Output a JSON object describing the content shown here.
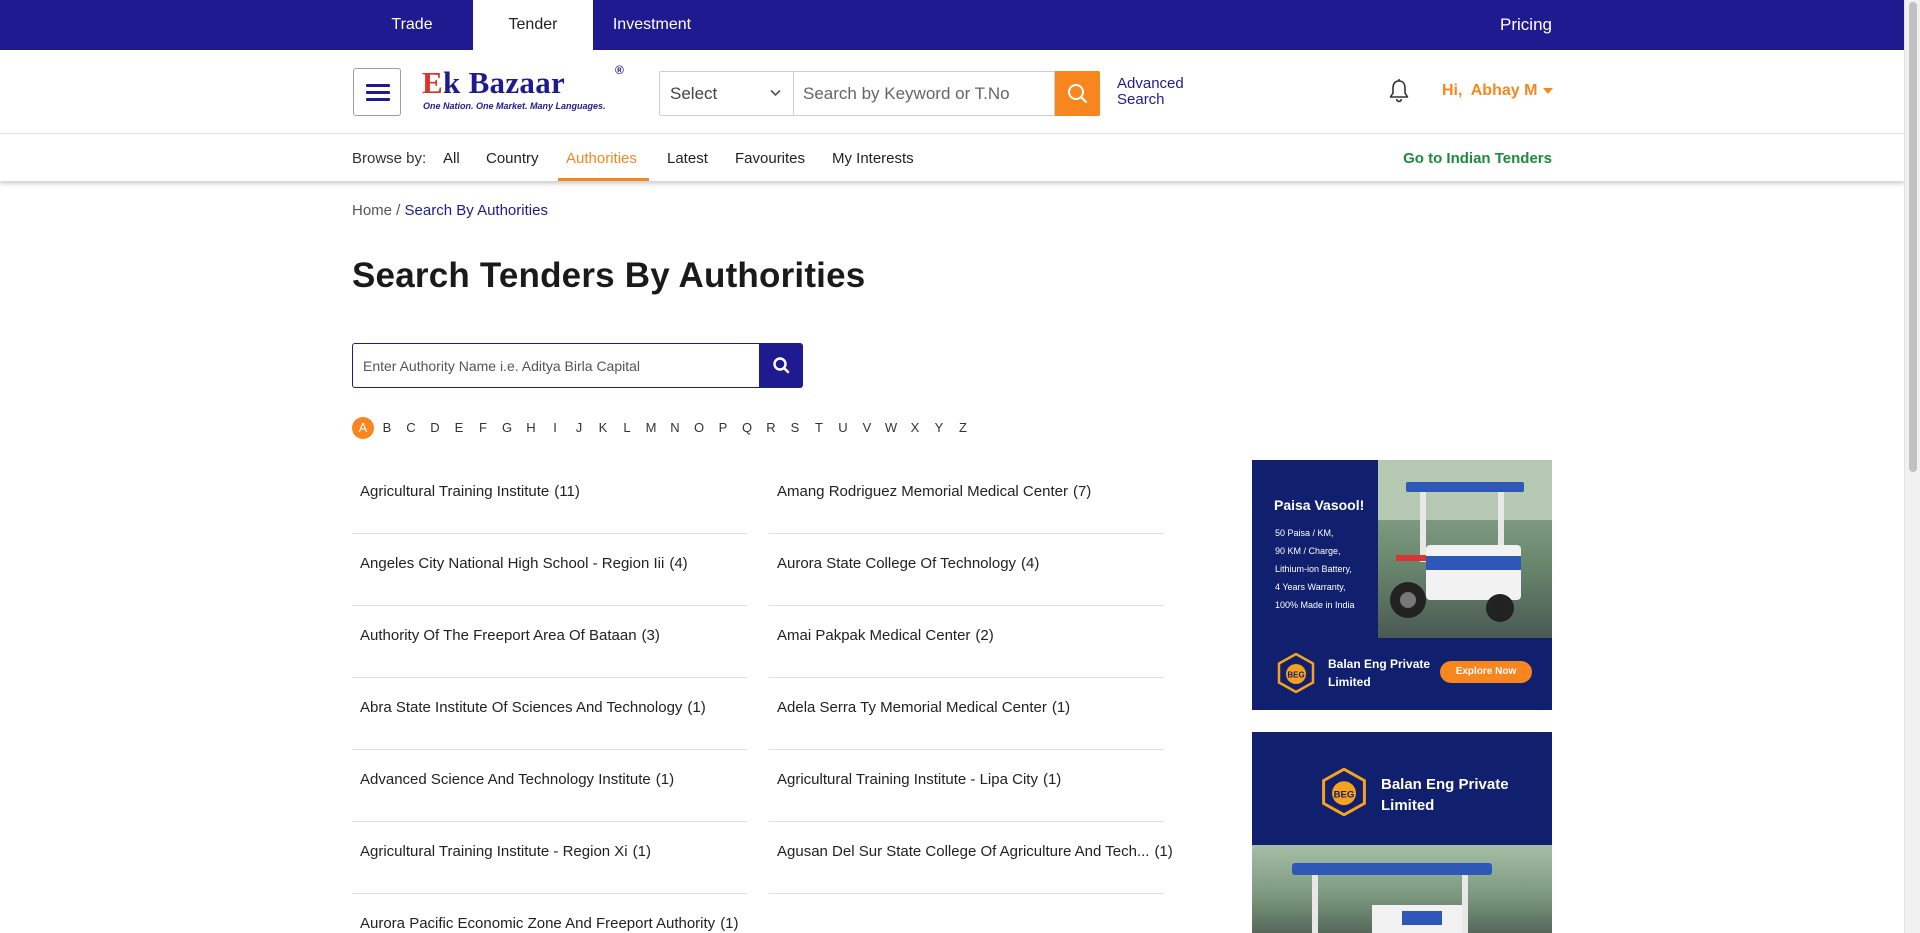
{
  "topbar": {
    "tabs": [
      {
        "label": "Trade"
      },
      {
        "label": "Tender",
        "active": true
      },
      {
        "label": "Investment"
      }
    ],
    "pricing_label": "Pricing"
  },
  "header": {
    "logo": {
      "text_main": "Ek Bazaar",
      "reg_mark": "®",
      "tagline": "One Nation. One Market. Many Languages."
    },
    "select_value": "Select",
    "search_placeholder": "Search by Keyword or T.No",
    "advanced_search_label": "Advanced Search",
    "user_greeting": "Hi,  Abhay M"
  },
  "browse": {
    "label": "Browse by:",
    "items": [
      "All",
      "Country",
      "Authorities",
      "Latest",
      "Favourites",
      "My Interests"
    ],
    "active": "Authorities",
    "goto_label": "Go to Indian Tenders"
  },
  "breadcrumb": {
    "home": "Home",
    "separator": " / ",
    "current": "Search By Authorities"
  },
  "page_title": "Search Tenders By Authorities",
  "authority_search": {
    "placeholder": "Enter Authority Name i.e. Aditya Birla Capital"
  },
  "alphabet": {
    "letters": [
      "A",
      "B",
      "C",
      "D",
      "E",
      "F",
      "G",
      "H",
      "I",
      "J",
      "K",
      "L",
      "M",
      "N",
      "O",
      "P",
      "Q",
      "R",
      "S",
      "T",
      "U",
      "V",
      "W",
      "X",
      "Y",
      "Z"
    ],
    "active": "A"
  },
  "authorities_left": [
    {
      "name": "Agricultural Training Institute",
      "count": "(11)"
    },
    {
      "name": "Angeles City National High School - Region Iii",
      "count": "(4)"
    },
    {
      "name": "Authority Of The Freeport Area Of Bataan",
      "count": "(3)"
    },
    {
      "name": "Abra State Institute Of Sciences And Technology",
      "count": "(1)"
    },
    {
      "name": "Advanced Science And Technology Institute",
      "count": "(1)"
    },
    {
      "name": "Agricultural Training Institute - Region Xi",
      "count": "(1)"
    },
    {
      "name": "Aurora Pacific Economic Zone And Freeport Authority",
      "count": "(1)"
    }
  ],
  "authorities_right": [
    {
      "name": "Amang Rodriguez Memorial Medical Center",
      "count": "(7)"
    },
    {
      "name": "Aurora State College Of Technology",
      "count": "(4)"
    },
    {
      "name": "Amai Pakpak Medical Center",
      "count": "(2)"
    },
    {
      "name": "Adela Serra Ty Memorial Medical Center",
      "count": "(1)"
    },
    {
      "name": "Agricultural Training Institute - Lipa City",
      "count": "(1)"
    },
    {
      "name": "Agusan Del Sur State College Of Agriculture And Tech...",
      "count": "(1)"
    }
  ],
  "ads": {
    "ad1": {
      "headline": "Paisa Vasool!",
      "specs": [
        "50 Paisa / KM,",
        "90 KM / Charge,",
        "Lithium-ion Battery,",
        "4 Years Warranty,",
        "100% Made in India"
      ],
      "brand": "Balan Eng Private Limited",
      "logo_letters": "BEG",
      "cta": "Explore Now"
    },
    "ad2": {
      "brand": "Balan Eng Private Limited",
      "logo_letters": "BEG"
    }
  },
  "colors": {
    "primary": "#1f1a8f",
    "accent": "#f7861f",
    "green_link": "#1d8a3d",
    "ad_bg": "#101f6e"
  }
}
